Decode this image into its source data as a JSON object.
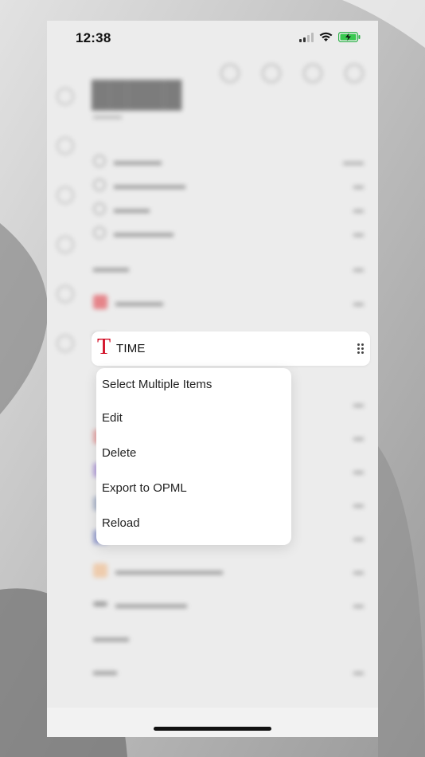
{
  "status_bar": {
    "time": "12:38"
  },
  "time_feed": {
    "logo": "T",
    "name": "TIME"
  },
  "context_menu": {
    "items": [
      {
        "label": "Select Multiple Items"
      },
      {
        "label": "Edit"
      },
      {
        "label": "Delete"
      },
      {
        "label": "Export to OPML"
      },
      {
        "label": "Reload"
      }
    ]
  },
  "colors": {
    "time_red": "#d0021b",
    "page_bg": "#ececec",
    "backdrop": "#b9b9b9"
  }
}
